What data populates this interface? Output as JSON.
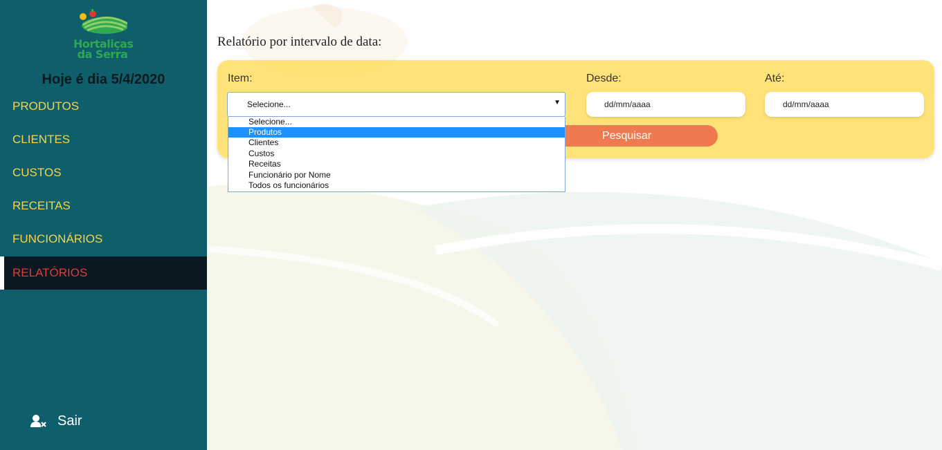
{
  "brand": {
    "line1": "Hortaliças",
    "line2": "da Serra"
  },
  "sidebar": {
    "date_text": "Hoje é dia 5/4/2020",
    "items": [
      {
        "label": "PRODUTOS"
      },
      {
        "label": "CLIENTES"
      },
      {
        "label": "CUSTOS"
      },
      {
        "label": "RECEITAS"
      },
      {
        "label": "FUNCIONÁRIOS"
      },
      {
        "label": "RELATÓRIOS",
        "active": true
      }
    ],
    "logout_label": "Sair",
    "logout_icon": "user-remove-icon"
  },
  "report": {
    "title": "Relatório por intervalo de data:",
    "item_label": "Item:",
    "item_value": "Selecione...",
    "from_label": "Desde:",
    "from_value": "dd/mm/aaaa",
    "to_label": "Até:",
    "to_value": "dd/mm/aaaa",
    "search_label": "Pesquisar",
    "search_visible_label": "squisar"
  },
  "dropdown": {
    "options": [
      "Selecione...",
      "Produtos",
      "Clientes",
      "Custos",
      "Receitas",
      "Funcionário por Nome",
      "Todos os funcionários"
    ],
    "highlighted": "Produtos"
  },
  "colors": {
    "sidebar_bg": "#0f5e6b",
    "nav_text": "#f6d54a",
    "active_bg": "#0a1822",
    "active_text": "#e03b3b",
    "panel_bg": "#ffe07a",
    "button_bg": "#f07a50",
    "highlight": "#1e90ff"
  }
}
